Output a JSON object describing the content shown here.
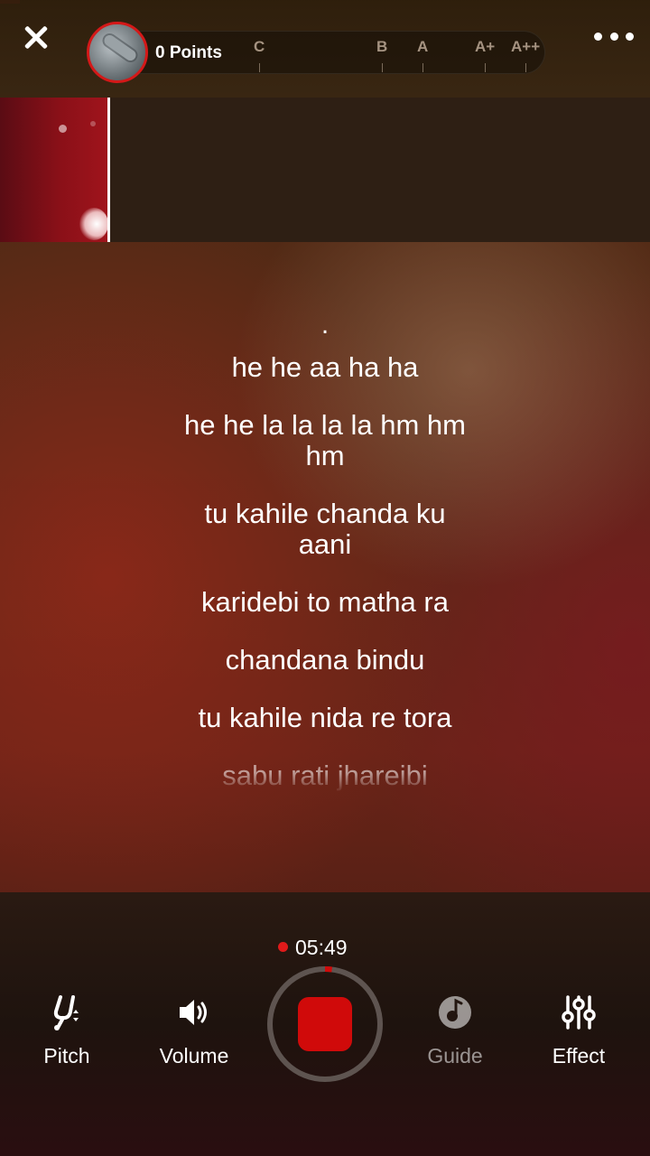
{
  "header": {
    "points_label": "0 Points",
    "grades": [
      "C",
      "B",
      "A",
      "A+",
      "A++"
    ]
  },
  "lyrics": {
    "current_marker": ".",
    "lines": [
      "he he aa ha ha",
      "he he la la la la hm hm hm",
      "tu kahile chanda ku aani",
      "karidebi to matha ra",
      "chandana bindu",
      "tu kahile nida re tora",
      "sabu rati jhareibi"
    ]
  },
  "recorder": {
    "time": "05:49",
    "progress": 0.02
  },
  "controls": {
    "pitch": "Pitch",
    "volume": "Volume",
    "guide": "Guide",
    "effect": "Effect"
  },
  "colors": {
    "accent": "#d00a0a",
    "record_dot": "#e01a1a"
  }
}
